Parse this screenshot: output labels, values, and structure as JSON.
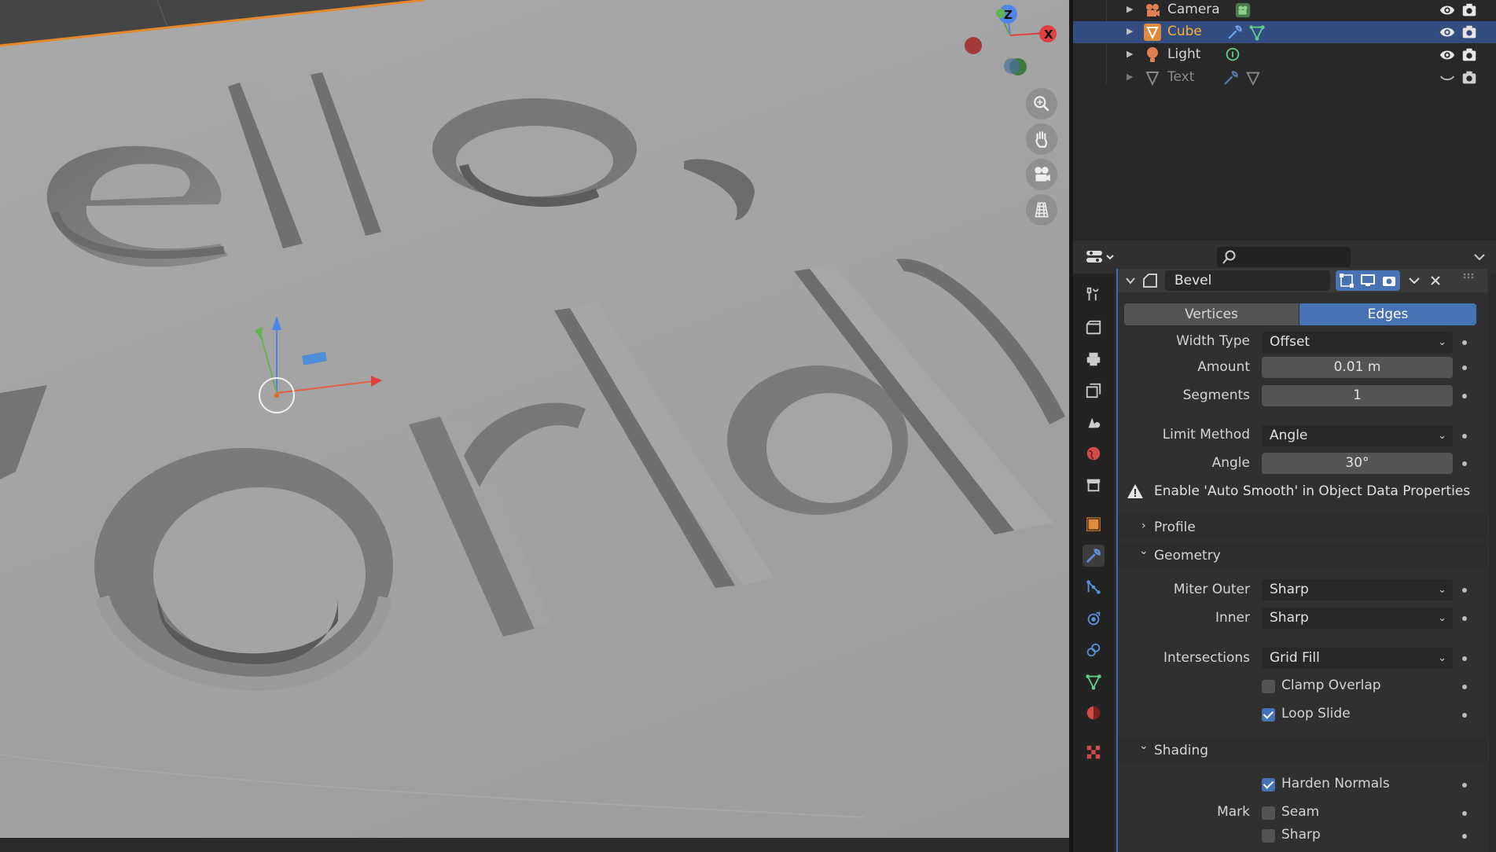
{
  "outliner": {
    "items": [
      {
        "name": "Camera",
        "selected": false,
        "dim": false
      },
      {
        "name": "Cube",
        "selected": true,
        "dim": false
      },
      {
        "name": "Light",
        "selected": false,
        "dim": false
      },
      {
        "name": "Text",
        "selected": false,
        "dim": true
      }
    ]
  },
  "viewport": {
    "gizmo_axes": {
      "z": "Z",
      "x": "X"
    }
  },
  "properties": {
    "search_placeholder": "",
    "modifier": {
      "name": "Bevel",
      "affect_tabs": [
        "Vertices",
        "Edges"
      ],
      "active_affect": "Edges",
      "width_type": {
        "label": "Width Type",
        "value": "Offset"
      },
      "amount": {
        "label": "Amount",
        "value": "0.01 m"
      },
      "segments": {
        "label": "Segments",
        "value": "1"
      },
      "limit_method": {
        "label": "Limit Method",
        "value": "Angle"
      },
      "angle": {
        "label": "Angle",
        "value": "30°"
      },
      "warning": "Enable 'Auto Smooth' in Object Data Properties",
      "sections": {
        "profile": "Profile",
        "geometry": "Geometry",
        "shading": "Shading"
      },
      "miter_outer": {
        "label": "Miter Outer",
        "value": "Sharp"
      },
      "inner": {
        "label": "Inner",
        "value": "Sharp"
      },
      "intersections": {
        "label": "Intersections",
        "value": "Grid Fill"
      },
      "clamp_overlap": {
        "label": "Clamp Overlap",
        "checked": false
      },
      "loop_slide": {
        "label": "Loop Slide",
        "checked": true
      },
      "harden_normals": {
        "label": "Harden Normals",
        "checked": true
      },
      "mark_label": "Mark",
      "seam": {
        "label": "Seam",
        "checked": false
      },
      "sharp": {
        "label": "Sharp",
        "checked": false
      }
    }
  },
  "colors": {
    "accent": "#4772b3",
    "selection": "#334d80",
    "active_object": "#ffaf29",
    "modifier_icon": "#5c8fd6"
  }
}
